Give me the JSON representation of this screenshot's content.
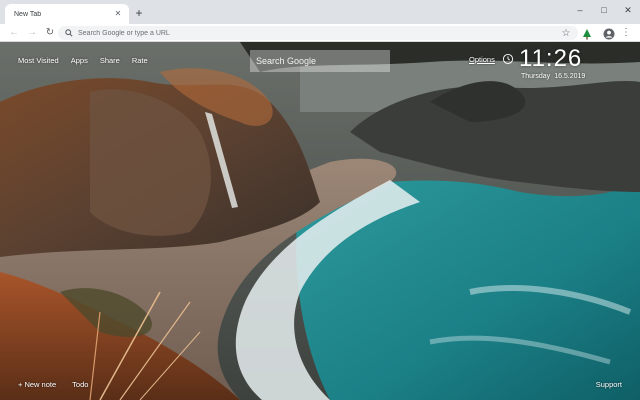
{
  "browser": {
    "tab": {
      "title": "New Tab",
      "close_icon": "close-icon"
    },
    "new_tab_symbol": "+",
    "window_controls": {
      "minimize": "–",
      "maximize": "□",
      "close": "✕"
    },
    "nav": {
      "back": "←",
      "forward": "→",
      "reload": "↻"
    },
    "omnibox": {
      "placeholder": "Search Google or type a URL",
      "value": ""
    },
    "bookmark_star": "☆",
    "menu": "⋮"
  },
  "newtab": {
    "links": [
      "Most Visited",
      "Apps",
      "Share",
      "Rate"
    ],
    "search": {
      "placeholder": "Search Google",
      "value": ""
    },
    "options_label": "Options",
    "time": "11:26",
    "weekday": "Thursday",
    "date": "16.5.2019",
    "footer": {
      "new_note": "+ New note",
      "todo": "Todo",
      "support": "Support"
    }
  },
  "colors": {
    "tab_strip": "#dee1e6",
    "toolbar": "#ffffff",
    "omnibox": "#f1f3f4",
    "sea": "#1f8a8f",
    "sand": "#8a7566",
    "cliff": "#4a3b31"
  }
}
